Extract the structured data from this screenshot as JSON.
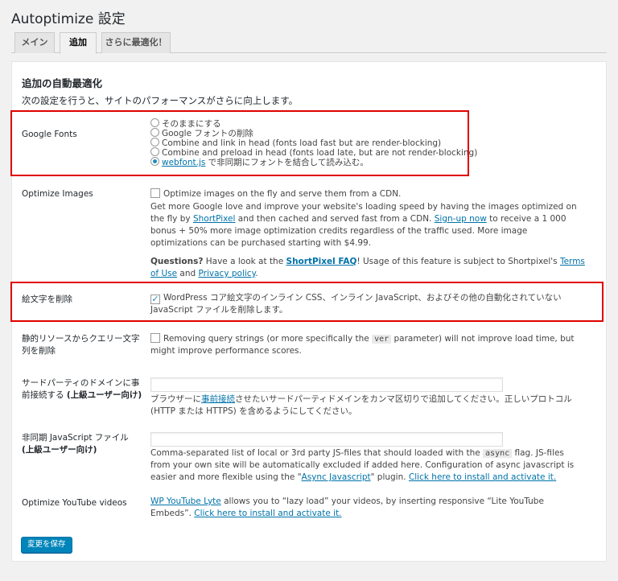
{
  "page": {
    "title": "Autoptimize 設定"
  },
  "tabs": [
    {
      "label": "メイン",
      "active": false
    },
    {
      "label": "追加",
      "active": true
    },
    {
      "label": "さらに最適化！",
      "active": false
    }
  ],
  "section": {
    "title": "追加の自動最適化",
    "description": "次の設定を行うと、サイトのパフォーマンスがさらに向上します。"
  },
  "google_fonts": {
    "label": "Google Fonts",
    "options": [
      {
        "text": "そのままにする",
        "checked": false
      },
      {
        "text": "Google フォントの削除",
        "checked": false
      },
      {
        "text": "Combine and link in head (fonts load fast but are render-blocking)",
        "checked": false
      },
      {
        "text": "Combine and preload in head (fonts load late, but are not render-blocking)",
        "checked": false
      },
      {
        "link": "webfont.js",
        "text": " で非同期にフォントを結合して読み込む。",
        "checked": true
      }
    ]
  },
  "optimize_images": {
    "label": "Optimize Images",
    "checkbox_label": "Optimize images on the fly and serve them from a CDN.",
    "checked": false,
    "desc_part1": "Get more Google love and improve your website's loading speed by having the images optimized on the fly by",
    "shortpixel_link": "ShortPixel",
    "desc_part2": " and then cached and served fast from a CDN. ",
    "signup_link": "Sign-up now",
    "desc_part3": " to receive a 1 000 bonus + 50% more image optimization credits regardless of the traffic used. More image optimizations can be purchased starting with $4.99.",
    "questions_label": "Questions?",
    "questions_text": " Have a look at the ",
    "faq_link": "ShortPixel FAQ",
    "usage_text": "! Usage of this feature is subject to Shortpixel's ",
    "terms_link": "Terms of Use",
    "and_text": " and ",
    "privacy_link": "Privacy policy",
    "period": "."
  },
  "emoji": {
    "label": "絵文字を削除",
    "checked": true,
    "text": "WordPress コア絵文字のインライン CSS、インライン JavaScript、およびその他の自動化されていない JavaScript ファイルを削除します。"
  },
  "query_strings": {
    "label": "静的リソースからクエリー文字列を削除",
    "checked": false,
    "text_before": "Removing query strings (or more specifically the ",
    "code": "ver",
    "text_after": " parameter) will not improve load time, but might improve performance scores."
  },
  "preconnect": {
    "label_line1": "サードパーティのドメインに事",
    "label_line2_plain": "前接続する ",
    "label_line2_bold": "(上級ユーザー向け)",
    "value": "",
    "desc_before": "ブラウザーに",
    "desc_link": "事前接続",
    "desc_after": "させたいサードパーティドメインをカンマ区切りで追加してください。正しいプロトコル (HTTP または HTTPS) を含めるようにしてください。"
  },
  "async_js": {
    "label_plain": "非同期 JavaScript ファイル ",
    "label_bold": "(上級ユーザー向け)",
    "value": "",
    "desc_before": "Comma-separated list of local or 3rd party JS-files that should loaded with the ",
    "code": "async",
    "desc_middle": " flag. JS-files from your own site will be automatically excluded if added here. Configuration of async javascript is easier and more flexible using the \"",
    "plugin_link": "Async Javascript",
    "desc_after": "\" plugin. ",
    "install_link": "Click here to install and activate it."
  },
  "youtube": {
    "label": "Optimize YouTube videos",
    "link": "WP YouTube Lyte",
    "text": " allows you to “lazy load” your videos, by inserting responsive “Lite YouTube Embeds”. ",
    "install_link": "Click here to install and activate it."
  },
  "save_button": {
    "label": "変更を保存"
  },
  "colors": {
    "accent": "#0085ba",
    "highlight": "#e00000",
    "link": "#0073aa"
  }
}
